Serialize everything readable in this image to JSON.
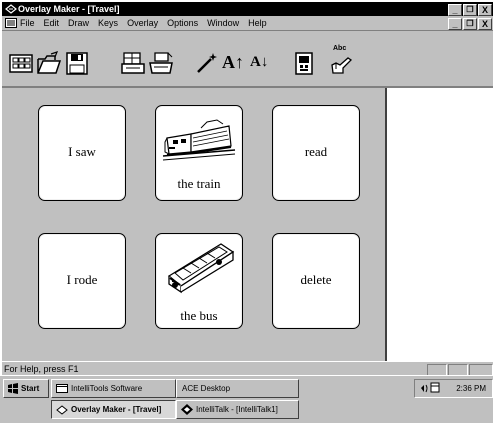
{
  "window": {
    "title": "Overlay Maker - [Travel]"
  },
  "menu": {
    "items": [
      "File",
      "Edit",
      "Draw",
      "Keys",
      "Overlay",
      "Options",
      "Window",
      "Help"
    ]
  },
  "window_controls": {
    "minimize": "_",
    "restore": "Д",
    "close": "X"
  },
  "toolbar": {
    "font_larger": "A↑",
    "font_smaller": "A↓",
    "spell_label": "Abc",
    "icons": [
      "grid-icon",
      "open-folder-icon",
      "save-disk-icon",
      "overlay-print-icon",
      "printer-icon",
      "magic-wand-icon",
      "font-larger-icon",
      "font-smaller-icon",
      "keyboard-icon",
      "spell-check-icon"
    ]
  },
  "keys": [
    {
      "label": "I saw",
      "picture": "none"
    },
    {
      "label": "the train",
      "picture": "train"
    },
    {
      "label": "read",
      "picture": "none"
    },
    {
      "label": "I rode",
      "picture": "none"
    },
    {
      "label": "the bus",
      "picture": "bus"
    },
    {
      "label": "delete",
      "picture": "none"
    }
  ],
  "status": {
    "text": "For Help, press F1"
  },
  "taskbar": {
    "start": "Start",
    "buttons": [
      "IntelliTools Software",
      "ACE Desktop",
      "Overlay Maker - [Travel]",
      "IntelliTalk - [IntelliTalk1]"
    ],
    "clock": "2:36 PM"
  },
  "colors": {
    "title_bar": "#000000",
    "face": "#c0c0c0",
    "key_background": "#ffffff"
  }
}
